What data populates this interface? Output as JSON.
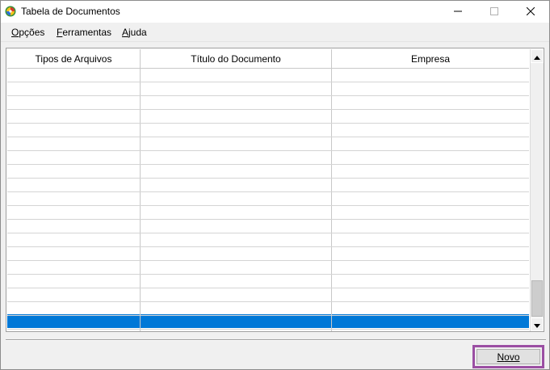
{
  "window": {
    "title": "Tabela de Documentos",
    "controls": {
      "minimize": "—",
      "maximize": "☐",
      "close": "✕"
    }
  },
  "menu": {
    "items": [
      {
        "label": "Opções",
        "access_key": "O",
        "rest": "pções"
      },
      {
        "label": "Ferramentas",
        "access_key": "F",
        "rest": "erramentas"
      },
      {
        "label": "Ajuda",
        "access_key": "A",
        "rest": "juda"
      }
    ]
  },
  "table": {
    "columns": [
      "Tipos de Arquivos",
      "Título do Documento",
      "Empresa"
    ],
    "rows": [
      [
        "",
        "",
        ""
      ],
      [
        "",
        "",
        ""
      ],
      [
        "",
        "",
        ""
      ],
      [
        "",
        "",
        ""
      ],
      [
        "",
        "",
        ""
      ],
      [
        "",
        "",
        ""
      ],
      [
        "",
        "",
        ""
      ],
      [
        "",
        "",
        ""
      ],
      [
        "",
        "",
        ""
      ],
      [
        "",
        "",
        ""
      ],
      [
        "",
        "",
        ""
      ],
      [
        "",
        "",
        ""
      ],
      [
        "",
        "",
        ""
      ],
      [
        "",
        "",
        ""
      ],
      [
        "",
        "",
        ""
      ],
      [
        "",
        "",
        ""
      ],
      [
        "",
        "",
        ""
      ],
      [
        "",
        "",
        ""
      ],
      [
        "",
        "",
        ""
      ]
    ],
    "selected_row_index": 18,
    "selection_color": "#0078d7"
  },
  "footer": {
    "new_button": {
      "label": "Novo",
      "access_key": "N",
      "rest": "ovo"
    },
    "highlight_color": "#9b4fa3"
  }
}
